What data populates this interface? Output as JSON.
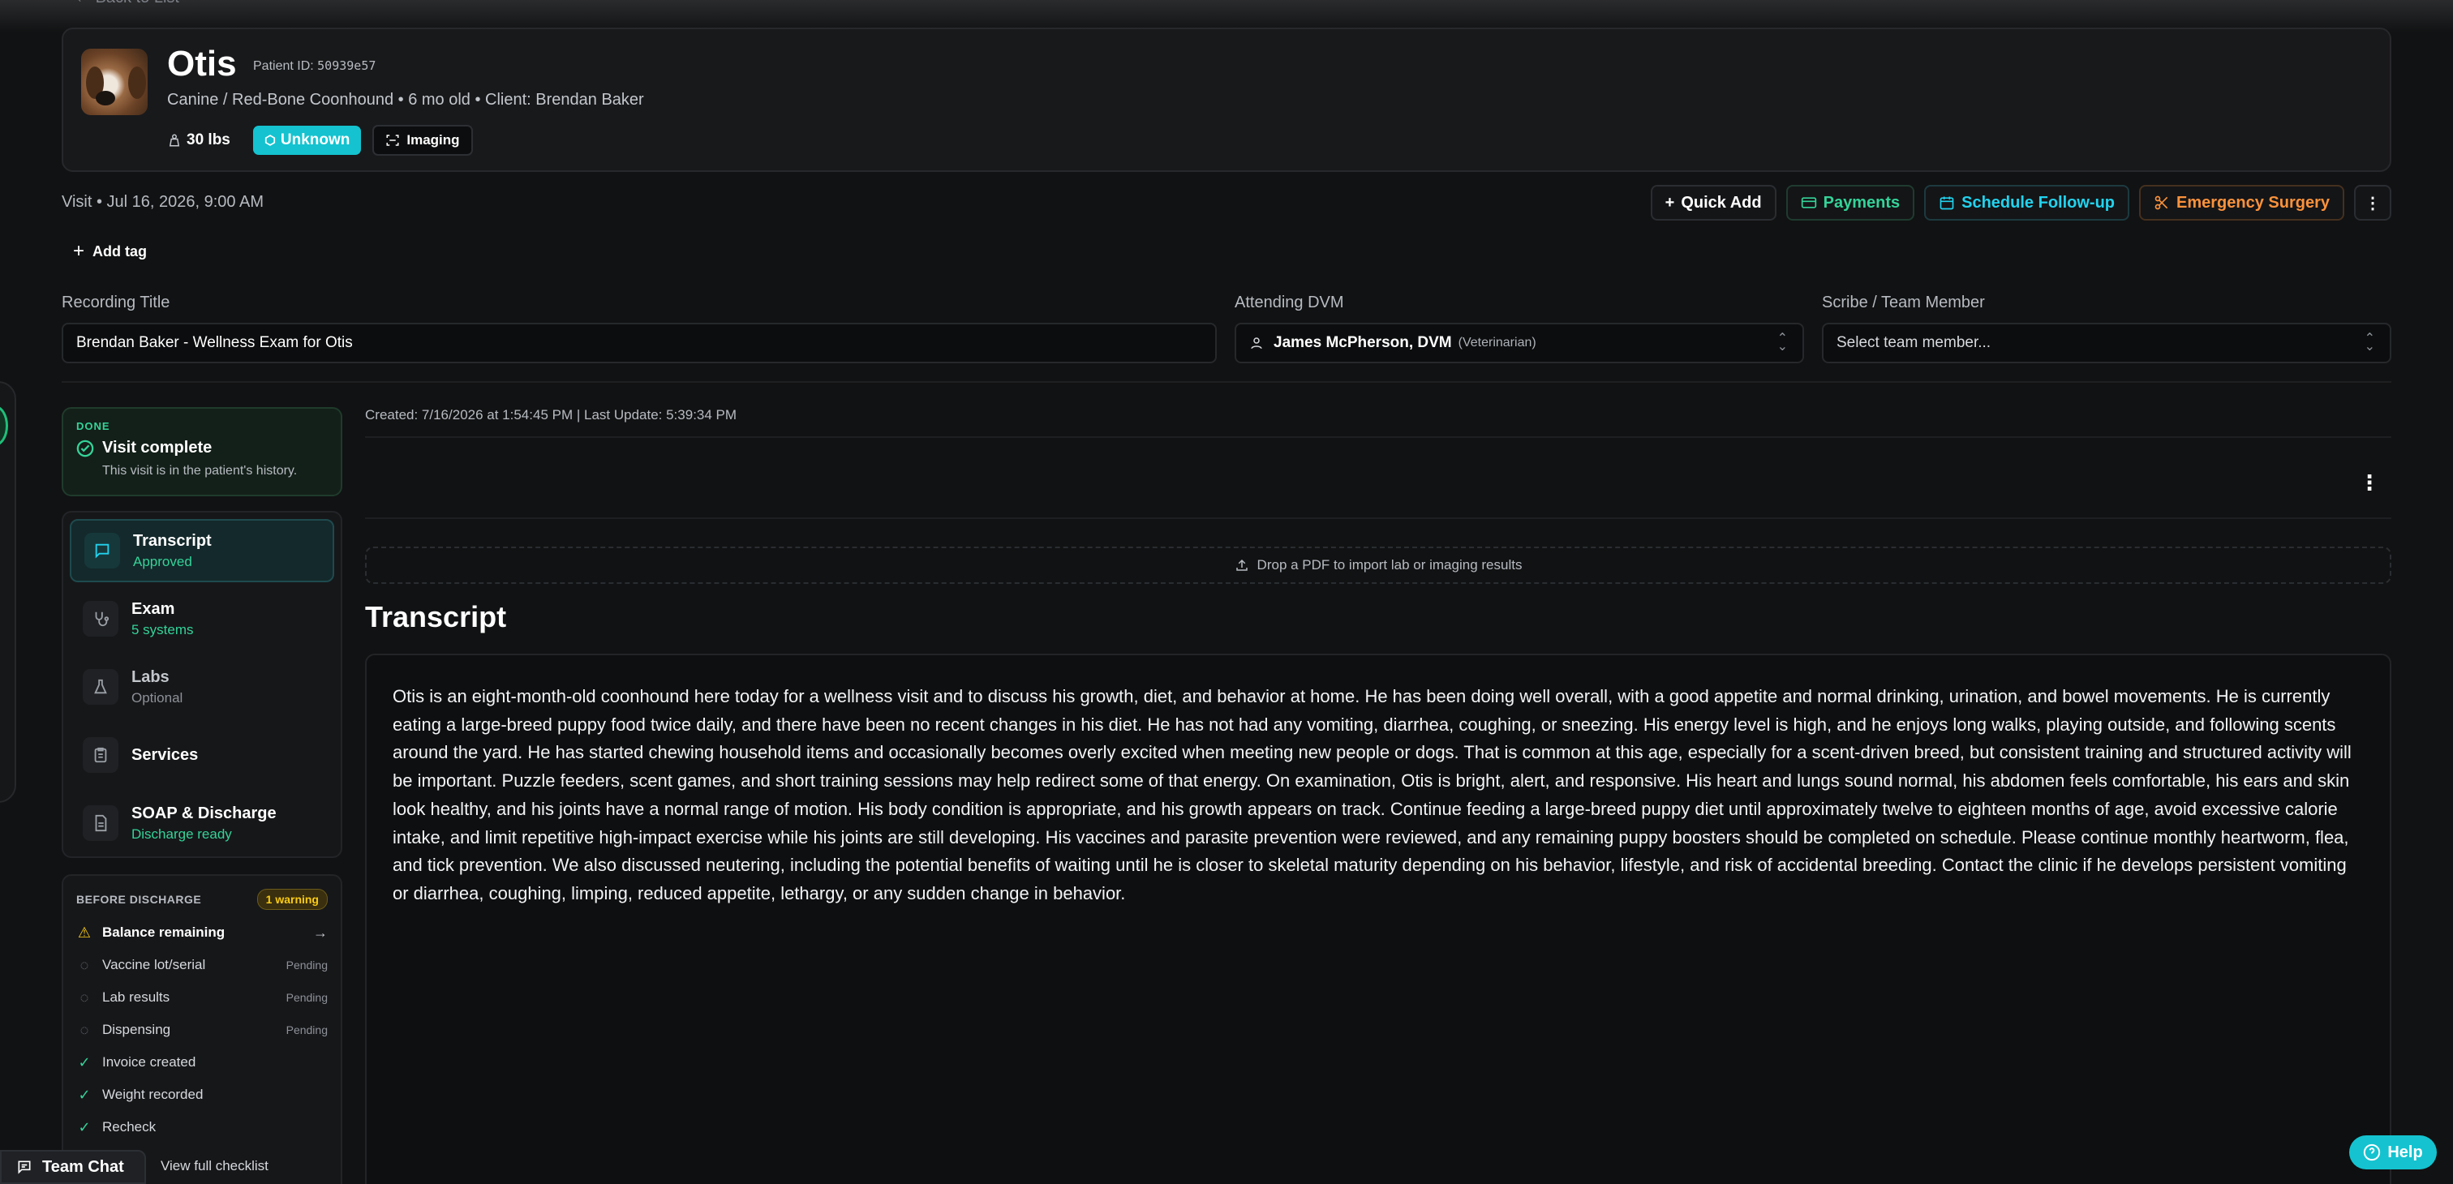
{
  "header": {
    "back_label": "Back to List",
    "patient_name": "Otis",
    "patient_id_label": "Patient ID:",
    "patient_id": "50939e57",
    "subtitle": "Canine / Red-Bone Coonhound • 6 mo old • Client: Brendan Baker",
    "weight": "30 lbs",
    "status_badge": "Unknown",
    "imaging_badge": "Imaging"
  },
  "visit": {
    "line": "Visit • Jul 16, 2026, 9:00 AM",
    "add_tag": "Add tag"
  },
  "actions": {
    "quick_add": "Quick Add",
    "payments": "Payments",
    "schedule": "Schedule Follow-up",
    "surgery": "Emergency Surgery"
  },
  "form": {
    "recording_title_label": "Recording Title",
    "recording_title_value": "Brendan Baker - Wellness Exam for Otis",
    "dvm_label": "Attending DVM",
    "dvm_value": "James McPherson, DVM",
    "dvm_role": "(Veterinarian)",
    "scribe_label": "Scribe / Team Member",
    "scribe_placeholder": "Select team member..."
  },
  "status": {
    "tag": "DONE",
    "title": "Visit complete",
    "subtitle": "This visit is in the patient's history."
  },
  "nav": [
    {
      "label": "Transcript",
      "sub": "Approved"
    },
    {
      "label": "Exam",
      "sub": "5 systems"
    },
    {
      "label": "Labs",
      "sub": "Optional"
    },
    {
      "label": "Services",
      "sub": ""
    },
    {
      "label": "SOAP & Discharge",
      "sub": "Discharge ready"
    }
  ],
  "checklist": {
    "title": "BEFORE DISCHARGE",
    "warning": "1 warning",
    "items": [
      {
        "label": "Balance remaining",
        "status": ""
      },
      {
        "label": "Vaccine lot/serial",
        "status": "Pending"
      },
      {
        "label": "Lab results",
        "status": "Pending"
      },
      {
        "label": "Dispensing",
        "status": "Pending"
      },
      {
        "label": "Invoice created",
        "status": ""
      },
      {
        "label": "Weight recorded",
        "status": ""
      },
      {
        "label": "Recheck",
        "status": ""
      }
    ],
    "view_full": "View full checklist"
  },
  "main": {
    "meta": "Created: 7/16/2026 at 1:54:45 PM | Last Update: 5:39:34 PM",
    "drop_zone": "Drop a PDF to import lab or imaging results",
    "section_title": "Transcript",
    "transcript": "Otis is an eight-month-old coonhound here today for a wellness visit and to discuss his growth, diet, and behavior at home. He has been doing well overall, with a good appetite and normal drinking, urination, and bowel movements. He is currently eating a large-breed puppy food twice daily, and there have been no recent changes in his diet. He has not had any vomiting, diarrhea, coughing, or sneezing. His energy level is high, and he enjoys long walks, playing outside, and following scents around the yard. He has started chewing household items and occasionally becomes overly excited when meeting new people or dogs. That is common at this age, especially for a scent-driven breed, but consistent training and structured activity will be important. Puzzle feeders, scent games, and short training sessions may help redirect some of that energy. On examination, Otis is bright, alert, and responsive. His heart and lungs sound normal, his abdomen feels comfortable, his ears and skin look healthy, and his joints have a normal range of motion. His body condition is appropriate, and his growth appears on track. Continue feeding a large-breed puppy diet until approximately twelve to eighteen months of age, avoid excessive calorie intake, and limit repetitive high-impact exercise while his joints are still developing. His vaccines and parasite prevention were reviewed, and any remaining puppy boosters should be completed on schedule. Please continue monthly heartworm, flea, and tick prevention. We also discussed neutering, including the potential benefits of waiting until he is closer to skeletal maturity depending on his behavior, lifestyle, and risk of accidental breeding. Contact the clinic if he develops persistent vomiting or diarrhea, coughing, limping, reduced appetite, lethargy, or any sudden change in behavior."
  },
  "footer": {
    "team_chat": "Team Chat",
    "help": "Help"
  }
}
